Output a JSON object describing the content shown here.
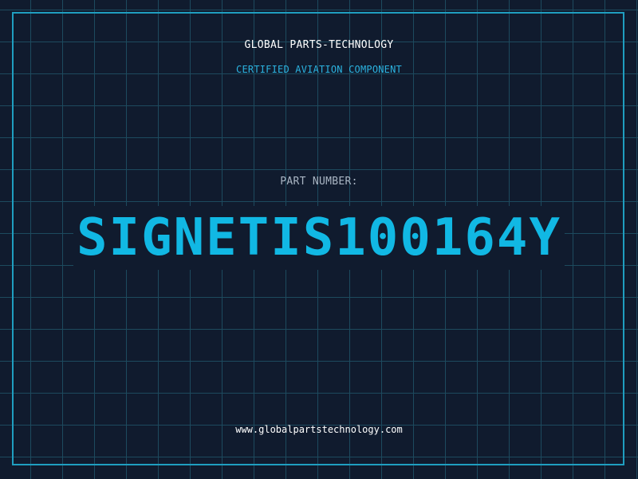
{
  "header": {
    "company_name": "GLOBAL PARTS-TECHNOLOGY",
    "subtitle": "CERTIFIED AVIATION COMPONENT"
  },
  "part": {
    "label": "PART NUMBER:",
    "number": "SIGNETIS100164Y"
  },
  "footer": {
    "website": "www.globalpartstechnology.com"
  },
  "colors": {
    "background": "#101b2e",
    "grid": "#1d4a5e",
    "frame": "#1f9ec0",
    "accent": "#11b8e4",
    "subtitle": "#2bb3e0",
    "label": "#aab6c4",
    "text": "#ffffff"
  }
}
